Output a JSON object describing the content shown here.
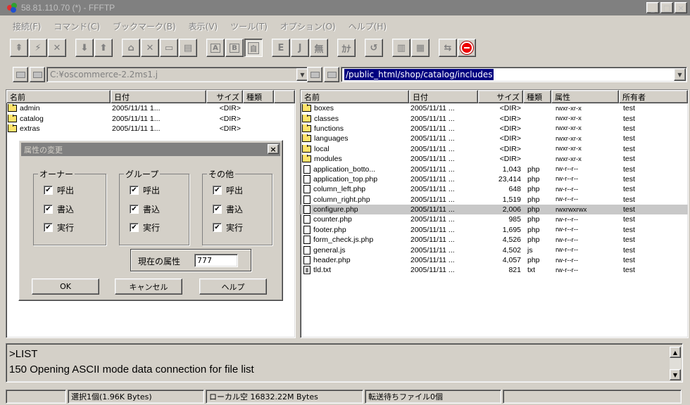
{
  "window": {
    "title": "58.81.110.70 (*) - FFFTP"
  },
  "menu": [
    "接続(F)",
    "コマンド(C)",
    "ブックマーク(B)",
    "表示(V)",
    "ツール(T)",
    "オプション(O)",
    "ヘルプ(H)"
  ],
  "toolbar": {
    "buttons": [
      "connect-icon",
      "quick-connect-icon",
      "disconnect-icon",
      "download-icon",
      "upload-icon",
      "home-icon",
      "delete-icon",
      "rename-icon",
      "mkdir-icon"
    ],
    "mode_a": "A",
    "mode_b": "B",
    "mode_auto": "自",
    "kana_e": "E",
    "kana_j": "J",
    "kana_none": "無",
    "kana_kana": "ｶﾅ",
    "refresh": "refresh-icon",
    "list": "list-icon",
    "detail": "detail-icon",
    "sync": "sync-icon",
    "stop": "stop-icon"
  },
  "local": {
    "path": "C:¥oscommerce-2.2ms1.j",
    "headers": {
      "name": "名前",
      "date": "日付",
      "size": "サイズ",
      "type": "種類"
    },
    "files": [
      {
        "name": "admin",
        "date": "2005/11/11 1...",
        "size": "<DIR>",
        "folder": true
      },
      {
        "name": "catalog",
        "date": "2005/11/11 1...",
        "size": "<DIR>",
        "folder": true
      },
      {
        "name": "extras",
        "date": "2005/11/11 1...",
        "size": "<DIR>",
        "folder": true
      }
    ]
  },
  "remote": {
    "path": "/public_html/shop/catalog/includes",
    "headers": {
      "name": "名前",
      "date": "日付",
      "size": "サイズ",
      "type": "種類",
      "attr": "属性",
      "owner": "所有者"
    },
    "files": [
      {
        "name": "boxes",
        "date": "2005/11/11 ...",
        "size": "<DIR>",
        "type": "",
        "attr": "rwxr-xr-x",
        "owner": "test",
        "folder": true
      },
      {
        "name": "classes",
        "date": "2005/11/11 ...",
        "size": "<DIR>",
        "type": "",
        "attr": "rwxr-xr-x",
        "owner": "test",
        "folder": true
      },
      {
        "name": "functions",
        "date": "2005/11/11 ...",
        "size": "<DIR>",
        "type": "",
        "attr": "rwxr-xr-x",
        "owner": "test",
        "folder": true
      },
      {
        "name": "languages",
        "date": "2005/11/11 ...",
        "size": "<DIR>",
        "type": "",
        "attr": "rwxr-xr-x",
        "owner": "test",
        "folder": true
      },
      {
        "name": "local",
        "date": "2005/11/11 ...",
        "size": "<DIR>",
        "type": "",
        "attr": "rwxr-xr-x",
        "owner": "test",
        "folder": true
      },
      {
        "name": "modules",
        "date": "2005/11/11 ...",
        "size": "<DIR>",
        "type": "",
        "attr": "rwxr-xr-x",
        "owner": "test",
        "folder": true
      },
      {
        "name": "application_botto...",
        "date": "2005/11/11 ...",
        "size": "1,043",
        "type": "php",
        "attr": "rw-r--r--",
        "owner": "test",
        "folder": false
      },
      {
        "name": "application_top.php",
        "date": "2005/11/11 ...",
        "size": "23,414",
        "type": "php",
        "attr": "rw-r--r--",
        "owner": "test",
        "folder": false
      },
      {
        "name": "column_left.php",
        "date": "2005/11/11 ...",
        "size": "648",
        "type": "php",
        "attr": "rw-r--r--",
        "owner": "test",
        "folder": false
      },
      {
        "name": "column_right.php",
        "date": "2005/11/11 ...",
        "size": "1,519",
        "type": "php",
        "attr": "rw-r--r--",
        "owner": "test",
        "folder": false
      },
      {
        "name": "configure.php",
        "date": "2005/11/11 ...",
        "size": "2,006",
        "type": "php",
        "attr": "rwxrwxrwx",
        "owner": "test",
        "folder": false,
        "highlight": true
      },
      {
        "name": "counter.php",
        "date": "2005/11/11 ...",
        "size": "985",
        "type": "php",
        "attr": "rw-r--r--",
        "owner": "test",
        "folder": false
      },
      {
        "name": "footer.php",
        "date": "2005/11/11 ...",
        "size": "1,695",
        "type": "php",
        "attr": "rw-r--r--",
        "owner": "test",
        "folder": false
      },
      {
        "name": "form_check.js.php",
        "date": "2005/11/11 ...",
        "size": "4,526",
        "type": "php",
        "attr": "rw-r--r--",
        "owner": "test",
        "folder": false
      },
      {
        "name": "general.js",
        "date": "2005/11/11 ...",
        "size": "4,502",
        "type": "js",
        "attr": "rw-r--r--",
        "owner": "test",
        "folder": false
      },
      {
        "name": "header.php",
        "date": "2005/11/11 ...",
        "size": "4,057",
        "type": "php",
        "attr": "rw-r--r--",
        "owner": "test",
        "folder": false
      },
      {
        "name": "tld.txt",
        "date": "2005/11/11 ...",
        "size": "821",
        "type": "txt",
        "attr": "rw-r--r--",
        "owner": "test",
        "folder": false,
        "txt": true
      }
    ]
  },
  "dialog": {
    "title": "属性の変更",
    "groups": [
      {
        "label": "オーナー",
        "items": [
          "呼出",
          "書込",
          "実行"
        ]
      },
      {
        "label": "グループ",
        "items": [
          "呼出",
          "書込",
          "実行"
        ]
      },
      {
        "label": "その他",
        "items": [
          "呼出",
          "書込",
          "実行"
        ]
      }
    ],
    "current_label": "現在の属性",
    "current_value": "777",
    "ok": "OK",
    "cancel": "キャンセル",
    "help": "ヘルプ"
  },
  "log": {
    "line1": ">LIST",
    "line2": "150 Opening ASCII mode data connection for file list"
  },
  "status": {
    "selected": "選択1個(1.96K Bytes)",
    "local_free": "ローカル空 16832.22M Bytes",
    "queue": "転送待ちファイル0個"
  }
}
